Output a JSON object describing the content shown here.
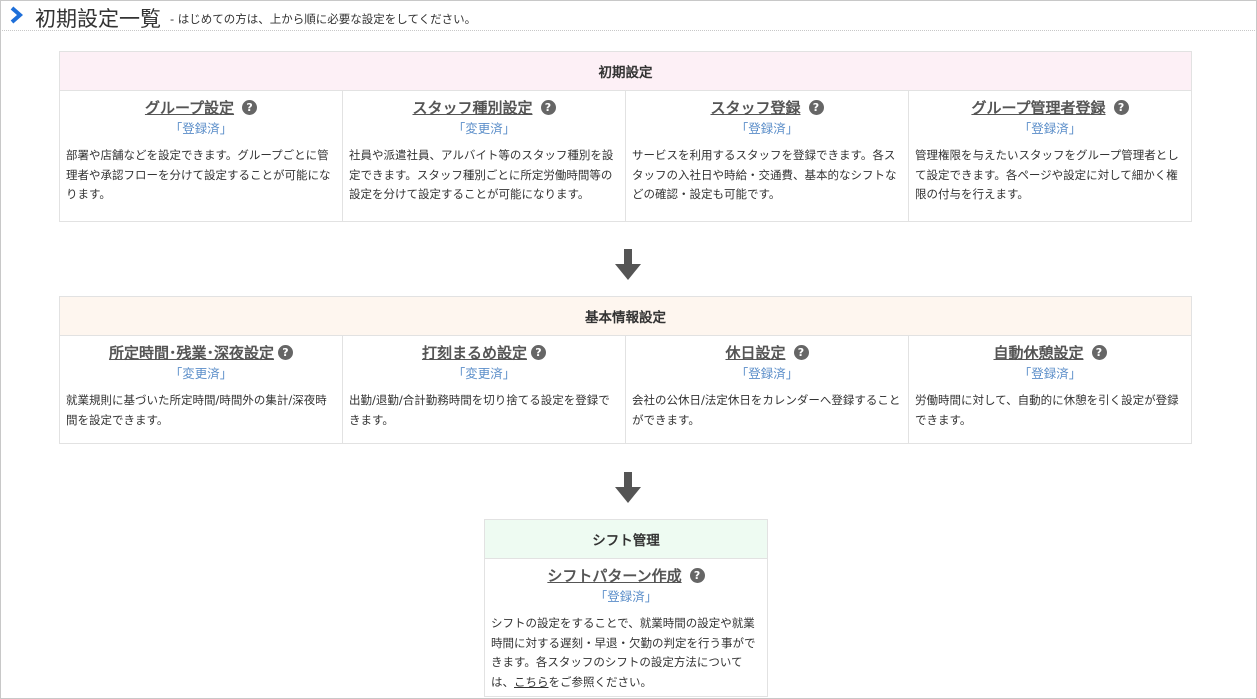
{
  "header": {
    "title": "初期設定一覧",
    "subtitle": "- はじめての方は、上から順に必要な設定をしてください。"
  },
  "colors": {
    "accent": "#1e6fd9",
    "section1_bg": "#fdf0f6",
    "section2_bg": "#fef6ef",
    "section3_bg": "#eefbf2",
    "status_text": "#5b8ec9"
  },
  "sections": [
    {
      "title": "初期設定",
      "items": [
        {
          "title": "グループ設定",
          "status": "「登録済」",
          "desc": "部署や店舗などを設定できます。グループごとに管理者や承認フローを分けて設定することが可能になります。"
        },
        {
          "title": "スタッフ種別設定",
          "status": "「変更済」",
          "desc": "社員や派遣社員、アルバイト等のスタッフ種別を設定できます。スタッフ種別ごとに所定労働時間等の設定を分けて設定することが可能になります。"
        },
        {
          "title": "スタッフ登録",
          "status": "「登録済」",
          "desc": "サービスを利用するスタッフを登録できます。各スタッフの入社日や時給・交通費、基本的なシフトなどの確認・設定も可能です。"
        },
        {
          "title": "グループ管理者登録",
          "status": "「登録済」",
          "desc": "管理権限を与えたいスタッフをグループ管理者として設定できます。各ページや設定に対して細かく権限の付与を行えます。"
        }
      ]
    },
    {
      "title": "基本情報設定",
      "items": [
        {
          "title": "所定時間･残業･深夜設定",
          "status": "「変更済」",
          "desc": "就業規則に基づいた所定時間/時間外の集計/深夜時間を設定できます。"
        },
        {
          "title": "打刻まるめ設定",
          "status": "「変更済」",
          "desc": "出勤/退勤/合計勤務時間を切り捨てる設定を登録できます。"
        },
        {
          "title": "休日設定",
          "status": "「登録済」",
          "desc": "会社の公休日/法定休日をカレンダーへ登録することができます。"
        },
        {
          "title": "自動休憩設定",
          "status": "「登録済」",
          "desc": "労働時間に対して、自動的に休憩を引く設定が登録できます。"
        }
      ]
    },
    {
      "title": "シフト管理",
      "items": [
        {
          "title": "シフトパターン作成",
          "status": "「登録済」",
          "desc_before": "シフトの設定をすることで、就業時間の設定や就業時間に対する遅刻・早退・欠勤の判定を行う事ができます。各スタッフのシフトの設定方法については、",
          "desc_link": "こちら",
          "desc_after": "をご参照ください。"
        }
      ]
    }
  ],
  "help_glyph": "?"
}
